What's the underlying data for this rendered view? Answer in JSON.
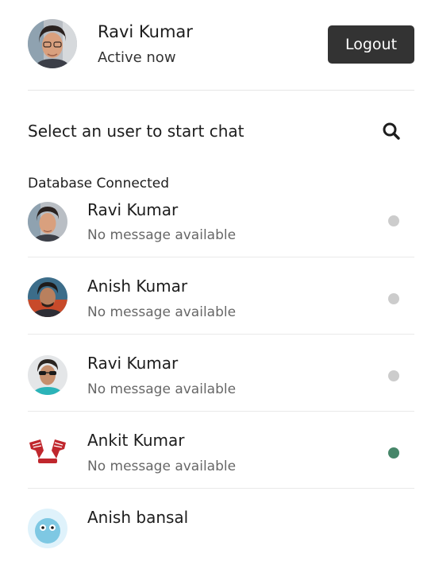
{
  "current_user": {
    "name": "Ravi Kumar",
    "status": "Active now"
  },
  "header": {
    "logout_label": "Logout"
  },
  "search": {
    "title": "Select an user to start chat",
    "icon": "search-icon"
  },
  "db_status": "Database Connected",
  "colors": {
    "logout_bg": "#333333",
    "offline_dot": "#cccccc",
    "online_dot": "#468669"
  },
  "users": [
    {
      "name": "Ravi Kumar",
      "message": "No message available",
      "online": false
    },
    {
      "name": "Anish Kumar",
      "message": "No message available",
      "online": false
    },
    {
      "name": "Ravi Kumar",
      "message": "No message available",
      "online": false
    },
    {
      "name": "Ankit Kumar",
      "message": "No message available",
      "online": true
    },
    {
      "name": "Anish bansal",
      "message": "",
      "online": false
    }
  ]
}
